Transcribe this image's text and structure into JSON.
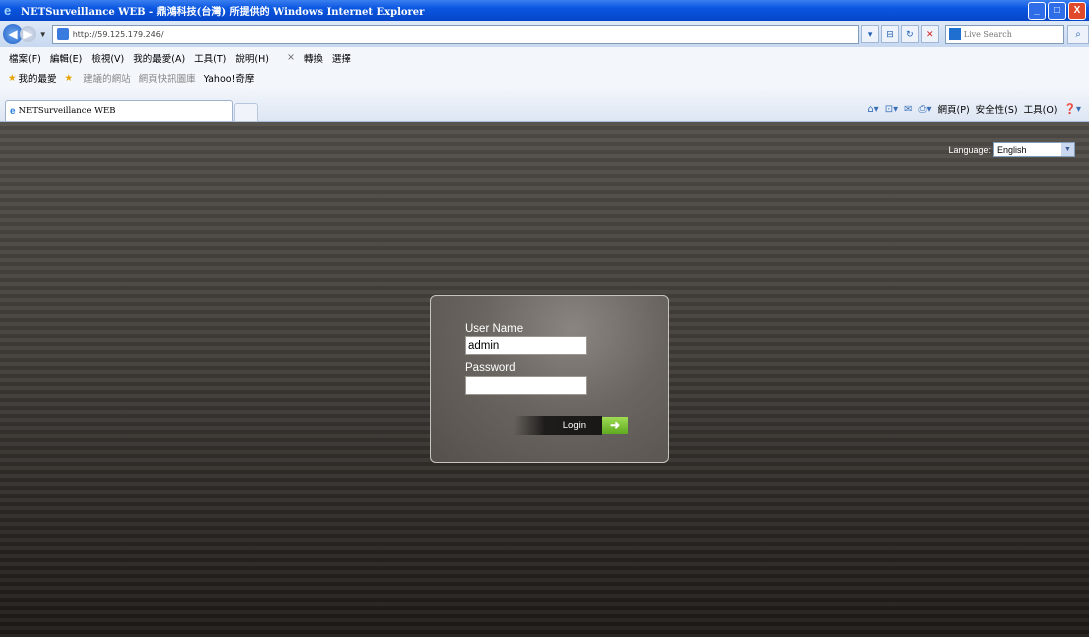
{
  "window": {
    "title": "NETSurveillance WEB - 鼎鴻科技(台灣) 所提供的 Windows Internet Explorer",
    "minimize": "_",
    "maximize": "□",
    "close": "X"
  },
  "address_bar": {
    "url": "http://59.125.179.246/",
    "search_placeholder": "Live Search"
  },
  "menu": [
    "檔案(F)",
    "編輯(E)",
    "檢視(V)",
    "我的最愛(A)",
    "工具(T)",
    "說明(H)",
    "轉換",
    "選擇"
  ],
  "favorites": {
    "label": "我的最愛",
    "items": [
      "建議的網站",
      "網頁快訊圖庫",
      "Yahoo!奇摩"
    ]
  },
  "tab": {
    "title": "NETSurveillance WEB"
  },
  "command_bar": {
    "page": "網頁(P)",
    "safety": "安全性(S)",
    "tools": "工具(O)"
  },
  "page": {
    "language_label": "Language:",
    "language_value": "English",
    "login": {
      "username_label": "User Name",
      "username_value": "admin",
      "password_label": "Password",
      "password_value": "",
      "button_label": "Login"
    }
  },
  "colors": {
    "title_bar": "#0a56e0",
    "page_bg": "#3f3b37",
    "login_arrow": "#7cc43a"
  }
}
